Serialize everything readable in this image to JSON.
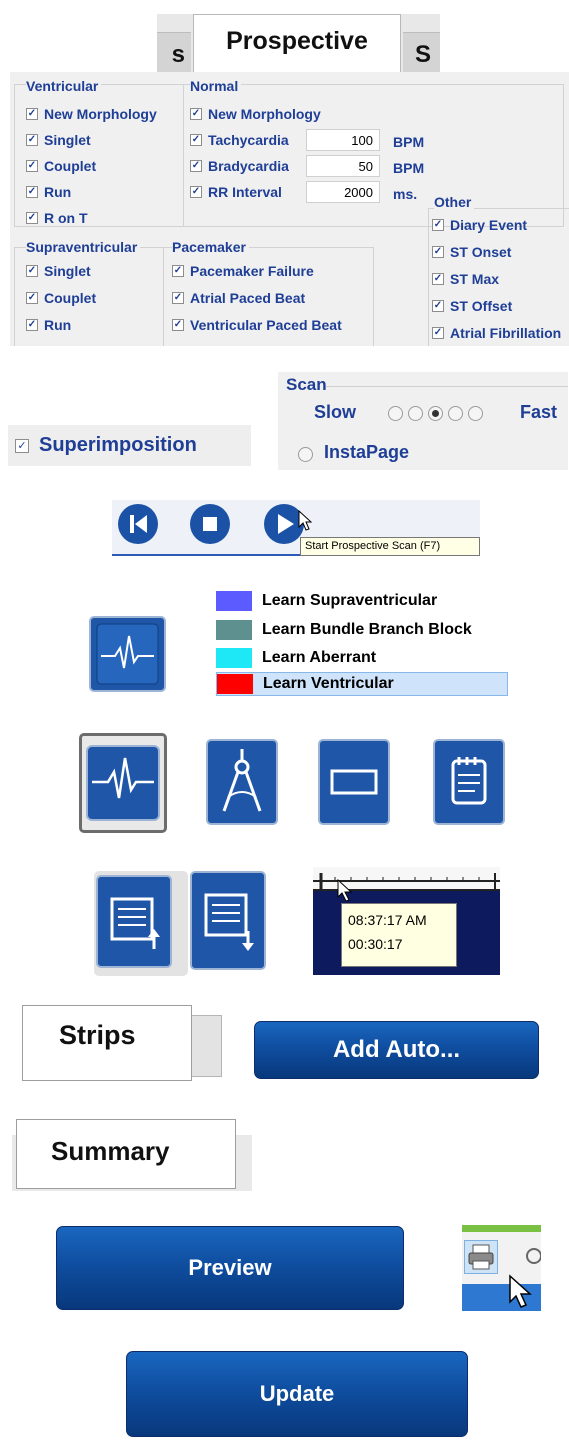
{
  "tabs": {
    "left_partial": "s",
    "active": "Prospective",
    "right_partial": "S"
  },
  "criteria": {
    "ventricular": {
      "title": "Ventricular",
      "items": [
        "New Morphology",
        "Singlet",
        "Couplet",
        "Run",
        "R on T"
      ]
    },
    "normal": {
      "title": "Normal",
      "new_morphology": "New Morphology",
      "tachycardia": {
        "label": "Tachycardia",
        "value": "100",
        "unit": "BPM"
      },
      "bradycardia": {
        "label": "Bradycardia",
        "value": "50",
        "unit": "BPM"
      },
      "rr_interval": {
        "label": "RR Interval",
        "value": "2000",
        "unit": "ms."
      }
    },
    "supraventricular": {
      "title": "Supraventricular",
      "items": [
        "Singlet",
        "Couplet",
        "Run"
      ]
    },
    "pacemaker": {
      "title": "Pacemaker",
      "items": [
        "Pacemaker Failure",
        "Atrial Paced Beat",
        "Ventricular Paced Beat"
      ]
    },
    "other": {
      "title": "Other",
      "items": [
        "Diary Event",
        "ST Onset",
        "ST Max",
        "ST Offset",
        "Atrial Fibrillation"
      ]
    }
  },
  "superimposition": {
    "label": "Superimposition",
    "checked": true
  },
  "scan": {
    "title": "Scan",
    "slow": "Slow",
    "fast": "Fast",
    "selected_speed": 3,
    "instapage": "InstaPage"
  },
  "transport": {
    "tooltip": "Start Prospective Scan (F7)"
  },
  "learn": {
    "items": [
      {
        "label": "Learn Supraventricular",
        "color": "#5b5bff"
      },
      {
        "label": "Learn Bundle Branch Block",
        "color": "#5f9090"
      },
      {
        "label": "Learn Aberrant",
        "color": "#1fe8f6"
      },
      {
        "label": "Learn Ventricular",
        "color": "#ff0000"
      }
    ]
  },
  "time_tooltip": {
    "clock": "08:37:17 AM",
    "elapsed": "00:30:17"
  },
  "strips_tab": "Strips",
  "add_auto": "Add Auto...",
  "summary_tab": "Summary",
  "preview": "Preview",
  "update": "Update",
  "colors": {
    "label_blue": "#1f3e96",
    "button_blue": "#0f4ea0",
    "icon_blue": "#1f56a8"
  }
}
